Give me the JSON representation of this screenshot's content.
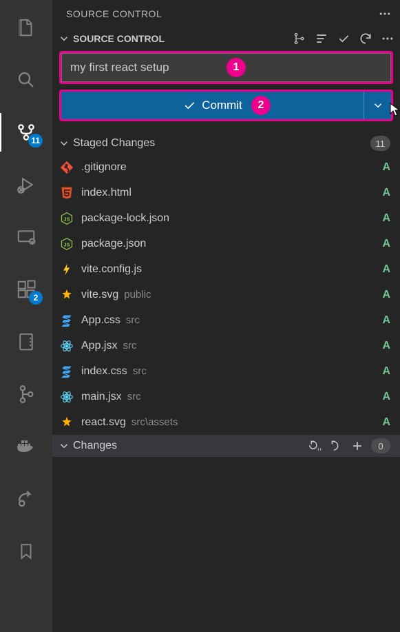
{
  "header": {
    "title": "SOURCE CONTROL"
  },
  "section": {
    "title": "SOURCE CONTROL"
  },
  "activity": {
    "scm_badge": "11",
    "extensions_badge": "2"
  },
  "commit": {
    "message": "my first react setup",
    "button_label": "Commit",
    "annotation1": "1",
    "annotation2": "2"
  },
  "staged": {
    "title": "Staged Changes",
    "count": "11",
    "files": [
      {
        "name": ".gitignore",
        "path": "",
        "status": "A",
        "icon": "git"
      },
      {
        "name": "index.html",
        "path": "",
        "status": "A",
        "icon": "html"
      },
      {
        "name": "package-lock.json",
        "path": "",
        "status": "A",
        "icon": "node"
      },
      {
        "name": "package.json",
        "path": "",
        "status": "A",
        "icon": "node"
      },
      {
        "name": "vite.config.js",
        "path": "",
        "status": "A",
        "icon": "vite"
      },
      {
        "name": "vite.svg",
        "path": "public",
        "status": "A",
        "icon": "svg"
      },
      {
        "name": "App.css",
        "path": "src",
        "status": "A",
        "icon": "css"
      },
      {
        "name": "App.jsx",
        "path": "src",
        "status": "A",
        "icon": "react"
      },
      {
        "name": "index.css",
        "path": "src",
        "status": "A",
        "icon": "css"
      },
      {
        "name": "main.jsx",
        "path": "src",
        "status": "A",
        "icon": "react"
      },
      {
        "name": "react.svg",
        "path": "src\\assets",
        "status": "A",
        "icon": "svg"
      }
    ]
  },
  "changes": {
    "title": "Changes",
    "count": "0"
  }
}
